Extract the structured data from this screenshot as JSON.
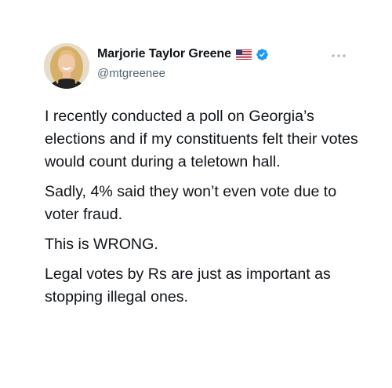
{
  "author": {
    "display_name": "Marjorie Taylor Greene",
    "handle": "@mtgreenee",
    "flag_icon": "us-flag-icon",
    "verified_icon": "verified-badge-icon",
    "verified_color": "#1d9bf0"
  },
  "menu": {
    "icon": "more-options-icon"
  },
  "tweet": {
    "paragraphs": [
      "I recently conducted a poll on Georgia’s elections and if my constituents felt their votes would count during a teletown hall.",
      "Sadly, 4% said they won’t even vote due to voter fraud.",
      "This is WRONG.",
      "Legal votes by Rs are just as important as stopping illegal ones."
    ]
  },
  "colors": {
    "text": "#0f1419",
    "secondary": "#536471",
    "background": "#ffffff"
  }
}
